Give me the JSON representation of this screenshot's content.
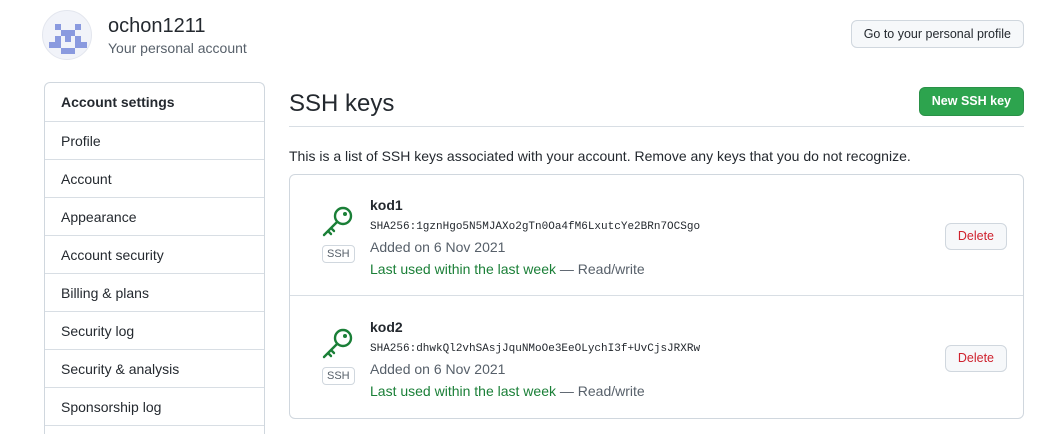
{
  "header": {
    "username": "ochon1211",
    "subtitle": "Your personal account",
    "profile_button": "Go to your personal profile"
  },
  "sidebar": {
    "heading": "Account settings",
    "items": [
      {
        "label": "Profile"
      },
      {
        "label": "Account"
      },
      {
        "label": "Appearance"
      },
      {
        "label": "Account security"
      },
      {
        "label": "Billing & plans"
      },
      {
        "label": "Security log"
      },
      {
        "label": "Security & analysis"
      },
      {
        "label": "Sponsorship log"
      }
    ]
  },
  "main": {
    "title": "SSH keys",
    "new_button": "New SSH key",
    "description": "This is a list of SSH keys associated with your account. Remove any keys that you do not recognize.",
    "keys": [
      {
        "title": "kod1",
        "fingerprint": "SHA256:1gznHgo5N5MJAXo2gTn0Oa4fM6LxutcYe2BRn7OCSgo",
        "added": "Added on 6 Nov 2021",
        "last_used": "Last used within the last week",
        "access": " — Read/write",
        "badge": "SSH",
        "delete_label": "Delete"
      },
      {
        "title": "kod2",
        "fingerprint": "SHA256:dhwkQl2vhSAsjJquNMoOe3EeOLychI3f+UvCjsJRXRw",
        "added": "Added on 6 Nov 2021",
        "last_used": "Last used within the last week",
        "access": " — Read/write",
        "badge": "SSH",
        "delete_label": "Delete"
      }
    ]
  },
  "colors": {
    "primary_button": "#2da44e",
    "danger_text": "#cf222e",
    "key_icon": "#1a7f37",
    "muted_text": "#57606a"
  },
  "icons": {
    "avatar": "identicon-avatar",
    "key": "key-icon"
  }
}
